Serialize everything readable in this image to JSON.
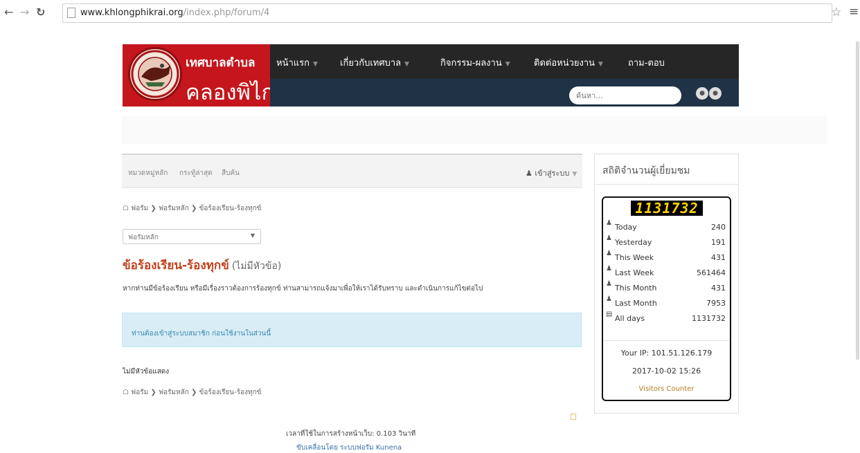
{
  "browser": {
    "back_icon": "arrow-left-icon",
    "forward_icon": "arrow-right-icon",
    "reload_icon": "reload-icon",
    "url_host": "www.khlongphikrai.org",
    "url_path": "/index.php/forum/4"
  },
  "site": {
    "logo_title": "เทศบาลตำบล",
    "logo_name": "คลองพิไกร",
    "nav": [
      {
        "label": "หน้าแรก",
        "has_caret": true
      },
      {
        "label": "เกี่ยวกับเทศบาล",
        "has_caret": true
      },
      {
        "label": "กิจกรรม-ผลงาน",
        "has_caret": true
      },
      {
        "label": "ติดต่อหน่วยงาน",
        "has_caret": true
      },
      {
        "label": "ถาม-ตอบ",
        "has_caret": false
      }
    ],
    "search_placeholder": "ค้นหา...",
    "colors": {
      "brand_red": "#c4161c",
      "nav_dark": "#262626",
      "nav_blue": "#1f3246",
      "title_orange": "#c1421e",
      "notice_bg": "#d9edf7"
    }
  },
  "forum": {
    "topbar_links": [
      "หมวดหมู่หลัก",
      "กระทู้ล่าสุด",
      "สืบค้น"
    ],
    "login": "เข้าสู่ระบบ",
    "breadcrumb": [
      "ฟอรัม",
      "ฟอรัมหลัก",
      "ข้อร้องเรียน-ร้องทุกข์"
    ],
    "select_value": "ฟอรัมหลัก",
    "category_title": "ข้อร้องเรียน-ร้องทุกข์",
    "category_sub": "(ไม่มีหัวข้อ)",
    "category_desc": "หากท่านมีข้อร้องเรียน หรือมีเรื่องราวต้องการร้องทุกข์ ท่านสามารถแจ้งมาเพื่อให้เราได้รับทราบ และดำเนินการแก้ไขต่อไป",
    "notice": "ท่านต้องเข้าสู่ระบบสมาชิก ก่อนใช้งานในส่วนนี้",
    "no_topics": "ไม่มีหัวข้อแสดง",
    "gen_time": "เวลาที่ใช้ในการสร้างหน้าเว็บ: 0.103 วินาที",
    "powered": "ขับเคลื่อนโดย ระบบฟอรัม Kunena"
  },
  "stats": {
    "title": "สถิติจำนวนผู้เยี่ยมชม",
    "counter_digits": "1131732",
    "rows": [
      {
        "label": "Today",
        "value": "240",
        "icon": "user-icon"
      },
      {
        "label": "Yesterday",
        "value": "191",
        "icon": "user-icon"
      },
      {
        "label": "This Week",
        "value": "431",
        "icon": "user-icon"
      },
      {
        "label": "Last Week",
        "value": "561464",
        "icon": "user-icon"
      },
      {
        "label": "This Month",
        "value": "431",
        "icon": "user-icon"
      },
      {
        "label": "Last Month",
        "value": "7953",
        "icon": "user-icon"
      },
      {
        "label": "All days",
        "value": "1131732",
        "icon": "chart-icon"
      }
    ],
    "your_ip": "Your IP: 101.51.126.179",
    "datetime": "2017-10-02 15:26",
    "link": "Visitors Counter"
  }
}
